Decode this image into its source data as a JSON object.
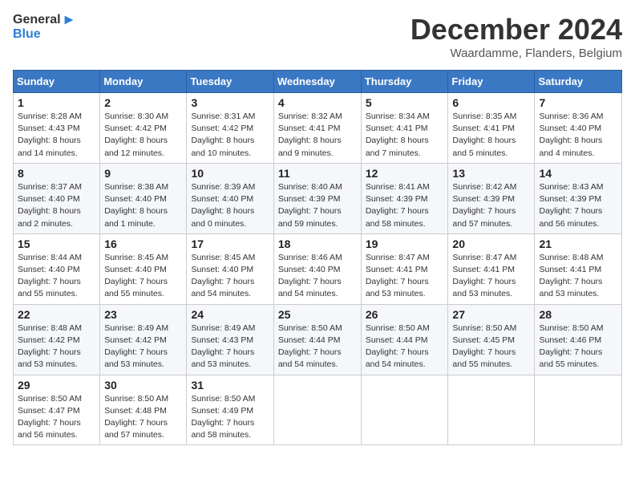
{
  "header": {
    "logo_general": "General",
    "logo_blue": "Blue",
    "month_title": "December 2024",
    "location": "Waardamme, Flanders, Belgium"
  },
  "calendar": {
    "headers": [
      "Sunday",
      "Monday",
      "Tuesday",
      "Wednesday",
      "Thursday",
      "Friday",
      "Saturday"
    ],
    "weeks": [
      [
        {
          "day": "1",
          "info": "Sunrise: 8:28 AM\nSunset: 4:43 PM\nDaylight: 8 hours\nand 14 minutes."
        },
        {
          "day": "2",
          "info": "Sunrise: 8:30 AM\nSunset: 4:42 PM\nDaylight: 8 hours\nand 12 minutes."
        },
        {
          "day": "3",
          "info": "Sunrise: 8:31 AM\nSunset: 4:42 PM\nDaylight: 8 hours\nand 10 minutes."
        },
        {
          "day": "4",
          "info": "Sunrise: 8:32 AM\nSunset: 4:41 PM\nDaylight: 8 hours\nand 9 minutes."
        },
        {
          "day": "5",
          "info": "Sunrise: 8:34 AM\nSunset: 4:41 PM\nDaylight: 8 hours\nand 7 minutes."
        },
        {
          "day": "6",
          "info": "Sunrise: 8:35 AM\nSunset: 4:41 PM\nDaylight: 8 hours\nand 5 minutes."
        },
        {
          "day": "7",
          "info": "Sunrise: 8:36 AM\nSunset: 4:40 PM\nDaylight: 8 hours\nand 4 minutes."
        }
      ],
      [
        {
          "day": "8",
          "info": "Sunrise: 8:37 AM\nSunset: 4:40 PM\nDaylight: 8 hours\nand 2 minutes."
        },
        {
          "day": "9",
          "info": "Sunrise: 8:38 AM\nSunset: 4:40 PM\nDaylight: 8 hours\nand 1 minute."
        },
        {
          "day": "10",
          "info": "Sunrise: 8:39 AM\nSunset: 4:40 PM\nDaylight: 8 hours\nand 0 minutes."
        },
        {
          "day": "11",
          "info": "Sunrise: 8:40 AM\nSunset: 4:39 PM\nDaylight: 7 hours\nand 59 minutes."
        },
        {
          "day": "12",
          "info": "Sunrise: 8:41 AM\nSunset: 4:39 PM\nDaylight: 7 hours\nand 58 minutes."
        },
        {
          "day": "13",
          "info": "Sunrise: 8:42 AM\nSunset: 4:39 PM\nDaylight: 7 hours\nand 57 minutes."
        },
        {
          "day": "14",
          "info": "Sunrise: 8:43 AM\nSunset: 4:39 PM\nDaylight: 7 hours\nand 56 minutes."
        }
      ],
      [
        {
          "day": "15",
          "info": "Sunrise: 8:44 AM\nSunset: 4:40 PM\nDaylight: 7 hours\nand 55 minutes."
        },
        {
          "day": "16",
          "info": "Sunrise: 8:45 AM\nSunset: 4:40 PM\nDaylight: 7 hours\nand 55 minutes."
        },
        {
          "day": "17",
          "info": "Sunrise: 8:45 AM\nSunset: 4:40 PM\nDaylight: 7 hours\nand 54 minutes."
        },
        {
          "day": "18",
          "info": "Sunrise: 8:46 AM\nSunset: 4:40 PM\nDaylight: 7 hours\nand 54 minutes."
        },
        {
          "day": "19",
          "info": "Sunrise: 8:47 AM\nSunset: 4:41 PM\nDaylight: 7 hours\nand 53 minutes."
        },
        {
          "day": "20",
          "info": "Sunrise: 8:47 AM\nSunset: 4:41 PM\nDaylight: 7 hours\nand 53 minutes."
        },
        {
          "day": "21",
          "info": "Sunrise: 8:48 AM\nSunset: 4:41 PM\nDaylight: 7 hours\nand 53 minutes."
        }
      ],
      [
        {
          "day": "22",
          "info": "Sunrise: 8:48 AM\nSunset: 4:42 PM\nDaylight: 7 hours\nand 53 minutes."
        },
        {
          "day": "23",
          "info": "Sunrise: 8:49 AM\nSunset: 4:42 PM\nDaylight: 7 hours\nand 53 minutes."
        },
        {
          "day": "24",
          "info": "Sunrise: 8:49 AM\nSunset: 4:43 PM\nDaylight: 7 hours\nand 53 minutes."
        },
        {
          "day": "25",
          "info": "Sunrise: 8:50 AM\nSunset: 4:44 PM\nDaylight: 7 hours\nand 54 minutes."
        },
        {
          "day": "26",
          "info": "Sunrise: 8:50 AM\nSunset: 4:44 PM\nDaylight: 7 hours\nand 54 minutes."
        },
        {
          "day": "27",
          "info": "Sunrise: 8:50 AM\nSunset: 4:45 PM\nDaylight: 7 hours\nand 55 minutes."
        },
        {
          "day": "28",
          "info": "Sunrise: 8:50 AM\nSunset: 4:46 PM\nDaylight: 7 hours\nand 55 minutes."
        }
      ],
      [
        {
          "day": "29",
          "info": "Sunrise: 8:50 AM\nSunset: 4:47 PM\nDaylight: 7 hours\nand 56 minutes."
        },
        {
          "day": "30",
          "info": "Sunrise: 8:50 AM\nSunset: 4:48 PM\nDaylight: 7 hours\nand 57 minutes."
        },
        {
          "day": "31",
          "info": "Sunrise: 8:50 AM\nSunset: 4:49 PM\nDaylight: 7 hours\nand 58 minutes."
        },
        null,
        null,
        null,
        null
      ]
    ]
  }
}
